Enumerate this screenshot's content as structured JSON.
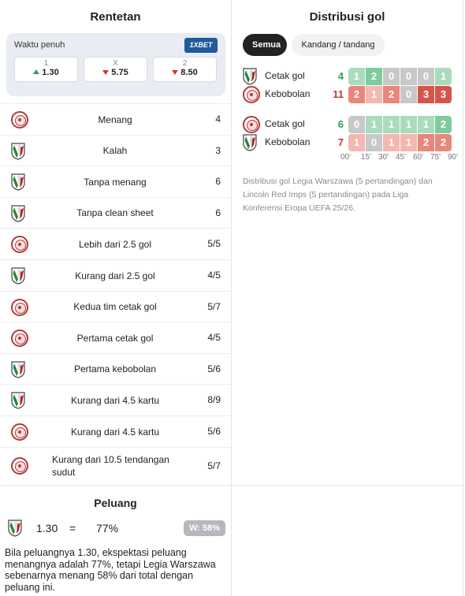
{
  "streaks": {
    "title": "Rentetan",
    "odds": {
      "label": "Waktu penuh",
      "bookmaker": "1XBET",
      "cells": [
        {
          "label": "1",
          "value": "1.30",
          "trend": "up"
        },
        {
          "label": "X",
          "value": "5.75",
          "trend": "down"
        },
        {
          "label": "2",
          "value": "8.50",
          "trend": "down"
        }
      ]
    },
    "rows": [
      {
        "team": "lincoln",
        "text": "Menang",
        "value": "4"
      },
      {
        "team": "legia",
        "text": "Kalah",
        "value": "3"
      },
      {
        "team": "legia",
        "text": "Tanpa menang",
        "value": "6"
      },
      {
        "team": "legia",
        "text": "Tanpa clean sheet",
        "value": "6"
      },
      {
        "team": "lincoln",
        "text": "Lebih dari 2.5 gol",
        "value": "5/5"
      },
      {
        "team": "legia",
        "text": "Kurang dari 2.5 gol",
        "value": "4/5"
      },
      {
        "team": "lincoln",
        "text": "Kedua tim cetak gol",
        "value": "5/7"
      },
      {
        "team": "lincoln",
        "text": "Pertama cetak gol",
        "value": "4/5"
      },
      {
        "team": "legia",
        "text": "Pertama kebobolan",
        "value": "5/6"
      },
      {
        "team": "legia",
        "text": "Kurang dari 4.5 kartu",
        "value": "8/9"
      },
      {
        "team": "lincoln",
        "text": "Kurang dari 4.5 kartu",
        "value": "5/6"
      },
      {
        "team": "lincoln",
        "text": "Kurang dari 10.5 tendangan sudut",
        "value": "5/7"
      }
    ]
  },
  "distribution": {
    "title": "Distribusi gol",
    "tabs": [
      "Semua",
      "Kandang / tandang"
    ],
    "groups": [
      {
        "rows": [
          {
            "team": "legia",
            "label": "Cetak gol",
            "total": "4",
            "kind": "scored",
            "cells": [
              "1",
              "2",
              "0",
              "0",
              "0",
              "1"
            ]
          },
          {
            "team": "lincoln",
            "label": "Kebobolan",
            "total": "11",
            "kind": "conceded",
            "cells": [
              "2",
              "1",
              "2",
              "0",
              "3",
              "3"
            ]
          }
        ]
      },
      {
        "rows": [
          {
            "team": "lincoln",
            "label": "Cetak gol",
            "total": "6",
            "kind": "scored",
            "cells": [
              "0",
              "1",
              "1",
              "1",
              "1",
              "2"
            ]
          },
          {
            "team": "legia",
            "label": "Kebobolan",
            "total": "7",
            "kind": "conceded",
            "cells": [
              "1",
              "0",
              "1",
              "1",
              "2",
              "2"
            ]
          }
        ]
      }
    ],
    "ticks": [
      "00'",
      "15'",
      "30'",
      "45'",
      "60'",
      "75'",
      "90'"
    ],
    "note": "Distribusi gol Legia Warszawa (5 pertandingan) dan Lincoln Red Imps (5 pertandingan) pada Liga Konferensi Eropa UEFA 25/26.",
    "colors": {
      "scored_total": "#2e9e5b",
      "conceded_total": "#c0392b",
      "scored": [
        "#c8c8c8",
        "#a9dcbd",
        "#7fcb9c",
        "#56b97c",
        "#2e9e5b"
      ],
      "conceded": [
        "#c8c8c8",
        "#f2b8b1",
        "#e8877c",
        "#d6554a",
        "#c0392b"
      ]
    }
  },
  "peluang": {
    "title": "Peluang",
    "odds": "1.30",
    "equals": "=",
    "percent": "77%",
    "badge": "W: 58%",
    "text": "Bila peluangnya 1.30, ekspektasi peluang menangnya adalah 77%, tetapi Legia Warszawa sebenarnya menang 58% dari total dengan peluang ini."
  }
}
